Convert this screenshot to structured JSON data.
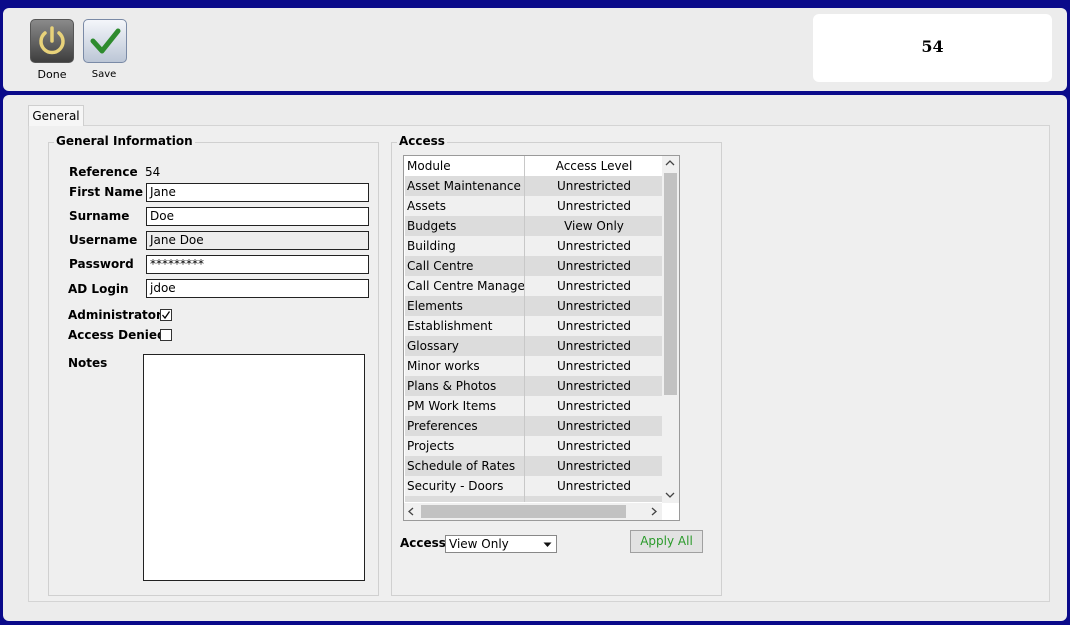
{
  "toolbar": {
    "done_label": "Done",
    "save_label": "Save"
  },
  "reference_display": "54",
  "tabs": [
    {
      "label": "General"
    }
  ],
  "general_info": {
    "legend": "General Information",
    "reference_label": "Reference",
    "reference_value": "54",
    "first_name_label": "First Name",
    "first_name_value": "Jane",
    "surname_label": "Surname",
    "surname_value": "Doe",
    "username_label": "Username",
    "username_value": "Jane Doe",
    "password_label": "Password",
    "password_value": "*********",
    "ad_login_label": "AD Login",
    "ad_login_value": "jdoe",
    "administrator_label": "Administrator",
    "administrator_checked": true,
    "access_denied_label": "Access Denied",
    "access_denied_checked": false,
    "notes_label": "Notes",
    "notes_value": ""
  },
  "access": {
    "legend": "Access",
    "columns": [
      "Module",
      "Access Level"
    ],
    "rows": [
      {
        "module": "Asset Maintenance",
        "level": "Unrestricted"
      },
      {
        "module": "Assets",
        "level": "Unrestricted"
      },
      {
        "module": "Budgets",
        "level": "View Only"
      },
      {
        "module": "Building",
        "level": "Unrestricted"
      },
      {
        "module": "Call Centre",
        "level": "Unrestricted"
      },
      {
        "module": "Call Centre Manager",
        "level": "Unrestricted"
      },
      {
        "module": "Elements",
        "level": "Unrestricted"
      },
      {
        "module": "Establishment",
        "level": "Unrestricted"
      },
      {
        "module": "Glossary",
        "level": "Unrestricted"
      },
      {
        "module": "Minor works",
        "level": "Unrestricted"
      },
      {
        "module": "Plans & Photos",
        "level": "Unrestricted"
      },
      {
        "module": "PM Work Items",
        "level": "Unrestricted"
      },
      {
        "module": "Preferences",
        "level": "Unrestricted"
      },
      {
        "module": "Projects",
        "level": "Unrestricted"
      },
      {
        "module": "Schedule of Rates",
        "level": "Unrestricted"
      },
      {
        "module": "Security - Doors",
        "level": "Unrestricted"
      }
    ],
    "access_label": "Access",
    "access_selected": "View Only",
    "apply_all_label": "Apply All"
  },
  "colors": {
    "frame": "#0a0a8a",
    "panel": "#ececec",
    "apply_text": "#2a9a2a"
  }
}
